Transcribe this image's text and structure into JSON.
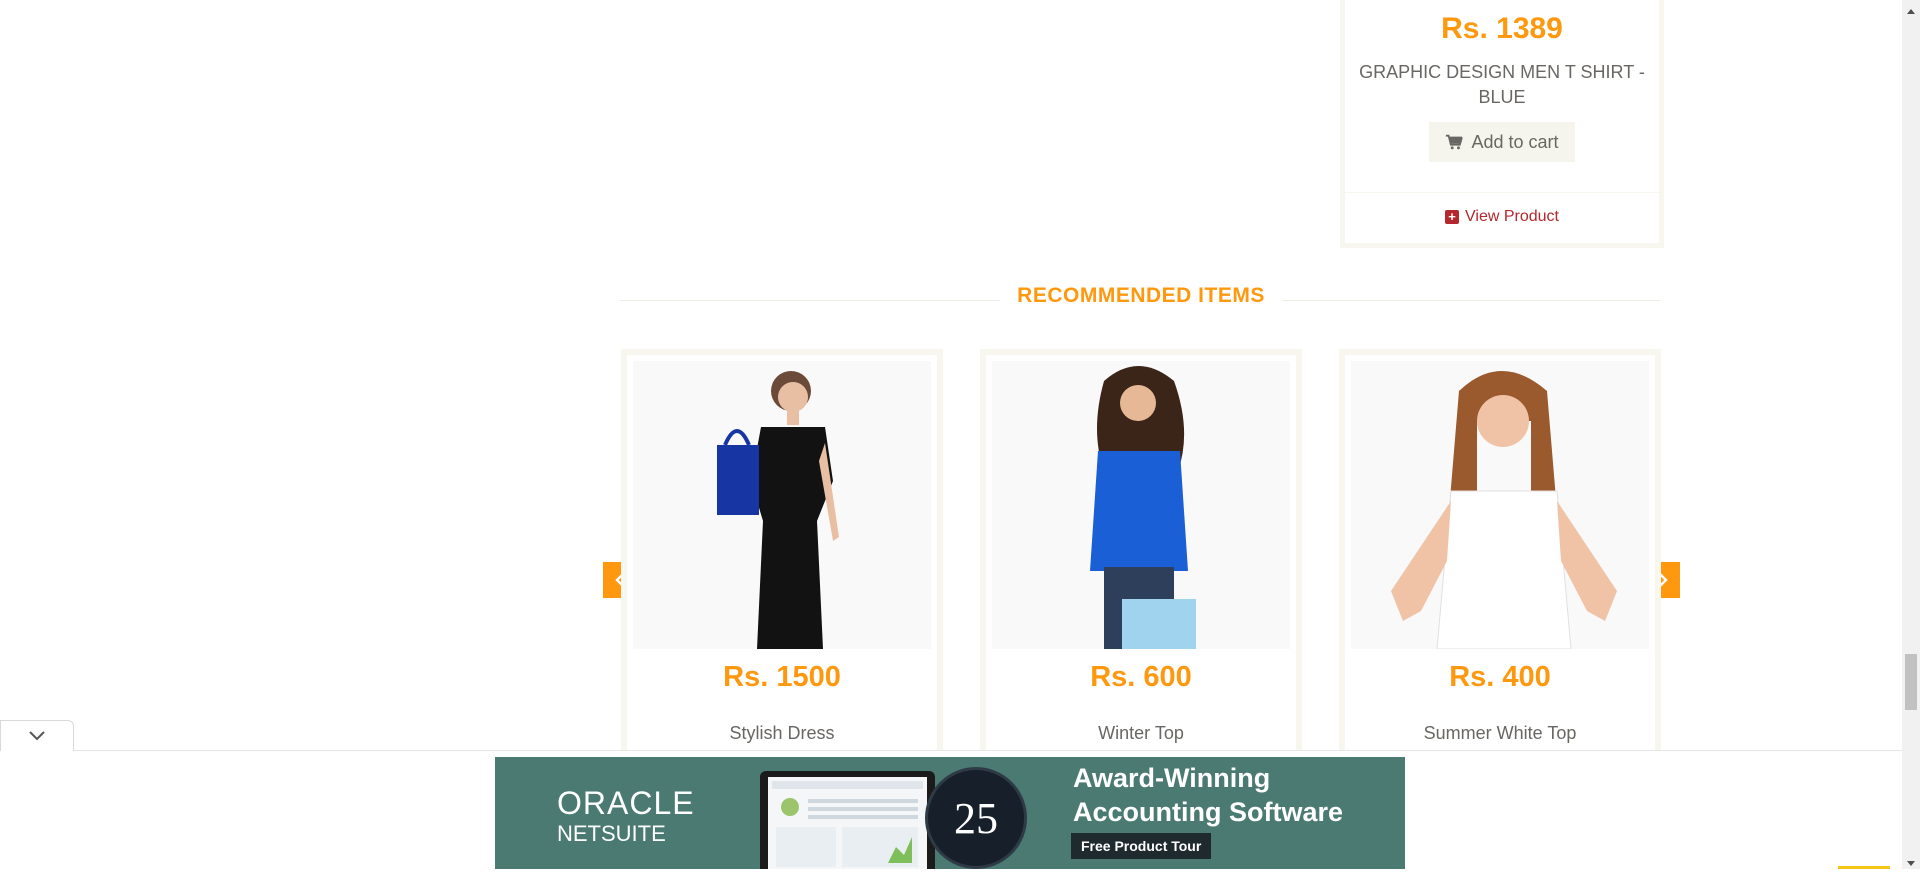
{
  "top_product": {
    "price": "Rs. 1389",
    "name": "GRAPHIC DESIGN MEN T SHIRT - BLUE",
    "add_to_cart_label": "Add to cart",
    "view_product_label": "View Product"
  },
  "recommended": {
    "title": "RECOMMENDED ITEMS",
    "items": [
      {
        "price": "Rs. 1500",
        "name": "Stylish Dress"
      },
      {
        "price": "Rs. 600",
        "name": "Winter Top"
      },
      {
        "price": "Rs. 400",
        "name": "Summer White Top"
      }
    ]
  },
  "ad": {
    "brand_line1": "ORACLE",
    "brand_line2": "NETSUITE",
    "badge": "25",
    "headline_line1": "Award-Winning",
    "headline_line2": "Accounting Software",
    "cta": "Free Product Tour"
  },
  "icons": {
    "cart": "shopping-cart-icon",
    "view": "plus-square-icon",
    "prev": "chevron-left-icon",
    "next": "chevron-right-icon",
    "collapse": "chevron-down-icon"
  },
  "colors": {
    "accent": "#FE980F",
    "link": "#B4272D",
    "text": "#696763",
    "ad_bg": "#4A7A72"
  }
}
